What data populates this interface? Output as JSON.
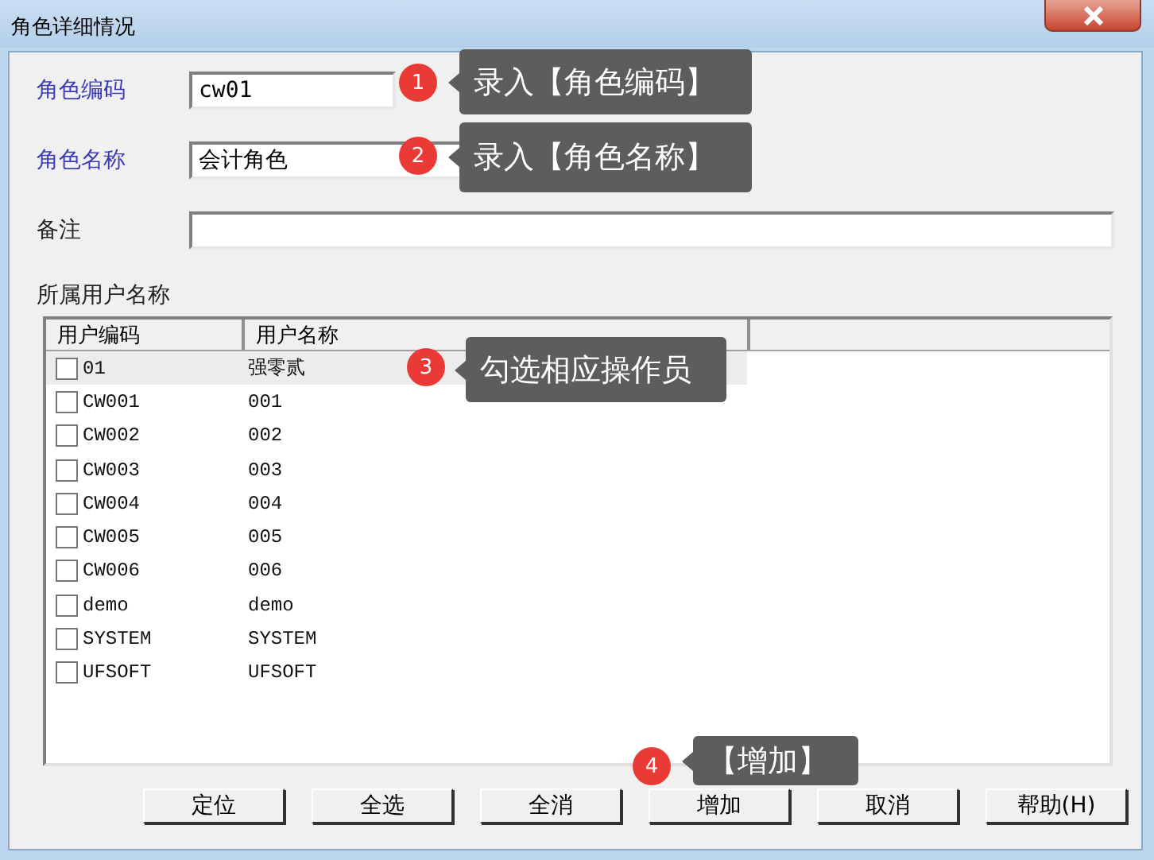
{
  "window": {
    "title": "角色详细情况"
  },
  "fields": [
    {
      "label": "角色编码",
      "value": "cw01",
      "kind": "short",
      "highlight": true
    },
    {
      "label": "角色名称",
      "value": "会计角色",
      "kind": "medium",
      "highlight": true
    },
    {
      "label": "备注",
      "kind": "long",
      "highlight": false
    }
  ],
  "users": {
    "title": "所属用户名称",
    "columns": [
      "用户编码",
      "用户名称"
    ],
    "rows": [
      {
        "code": "01",
        "name": "强零贰",
        "checked": false,
        "selected": true
      },
      {
        "code": "CW001",
        "name": "001",
        "checked": false,
        "selected": false
      },
      {
        "code": "CW002",
        "name": "002",
        "checked": false,
        "selected": false
      },
      {
        "code": "CW003",
        "name": "003",
        "checked": false,
        "selected": false
      },
      {
        "code": "CW004",
        "name": "004",
        "checked": false,
        "selected": false
      },
      {
        "code": "CW005",
        "name": "005",
        "checked": false,
        "selected": false
      },
      {
        "code": "CW006",
        "name": "006",
        "checked": false,
        "selected": false
      },
      {
        "code": "demo",
        "name": "demo",
        "checked": false,
        "selected": false
      },
      {
        "code": "SYSTEM",
        "name": "SYSTEM",
        "checked": false,
        "selected": false
      },
      {
        "code": "UFSOFT",
        "name": "UFSOFT",
        "checked": false,
        "selected": false
      }
    ]
  },
  "buttons": [
    "定位",
    "全选",
    "全消",
    "增加",
    "取消",
    "帮助(H)"
  ],
  "callouts": [
    {
      "number": "1",
      "text": "录入【角色编码】"
    },
    {
      "number": "2",
      "text": "录入【角色名称】"
    },
    {
      "number": "3",
      "text": "勾选相应操作员"
    },
    {
      "number": "4",
      "text": "【增加】"
    }
  ]
}
